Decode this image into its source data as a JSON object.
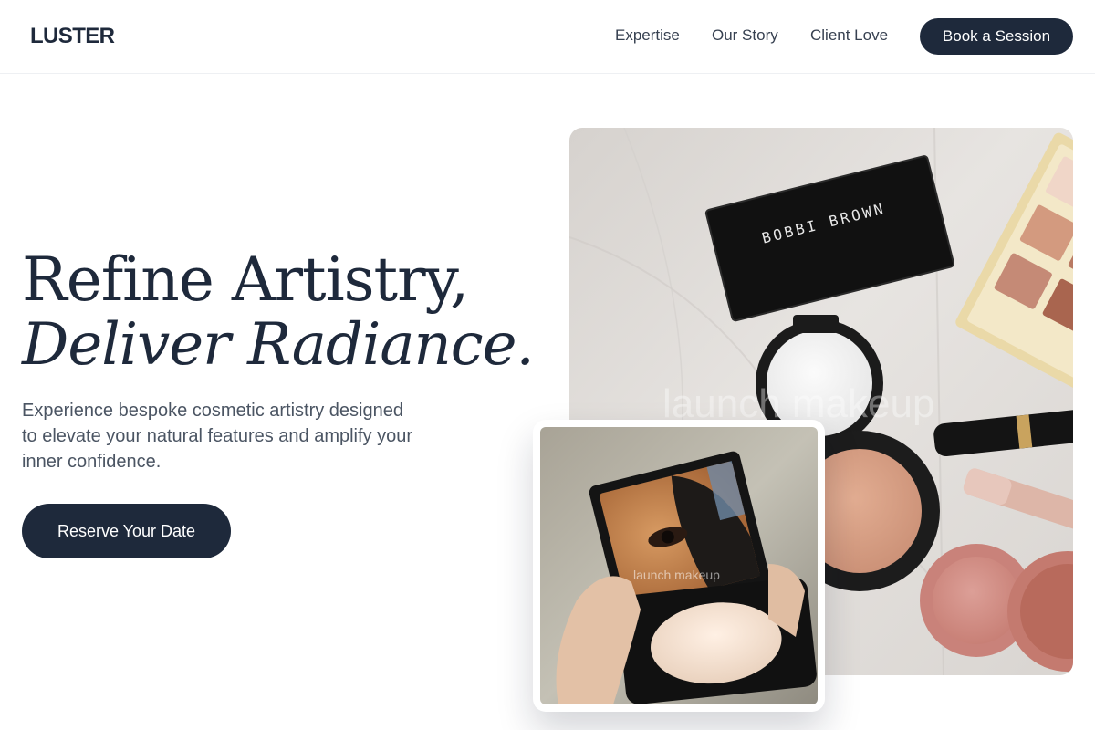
{
  "header": {
    "logo": "LUSTER",
    "nav": [
      "Expertise",
      "Our Story",
      "Client Love"
    ],
    "cta_label": "Book a Session"
  },
  "hero": {
    "title_line1": "Refine Artistry,",
    "title_line2": "Deliver Radiance.",
    "subtitle": "Experience bespoke cosmetic artistry designed to elevate your natural features and amplify your inner confidence.",
    "cta_label": "Reserve Your Date"
  },
  "images": {
    "main_brand_text": "BOBBI BROWN",
    "main_watermark": "launch makeup",
    "card_watermark": "launch makeup"
  },
  "colors": {
    "primary": "#1e293b",
    "text_muted": "#4b5563",
    "background": "#ffffff"
  }
}
